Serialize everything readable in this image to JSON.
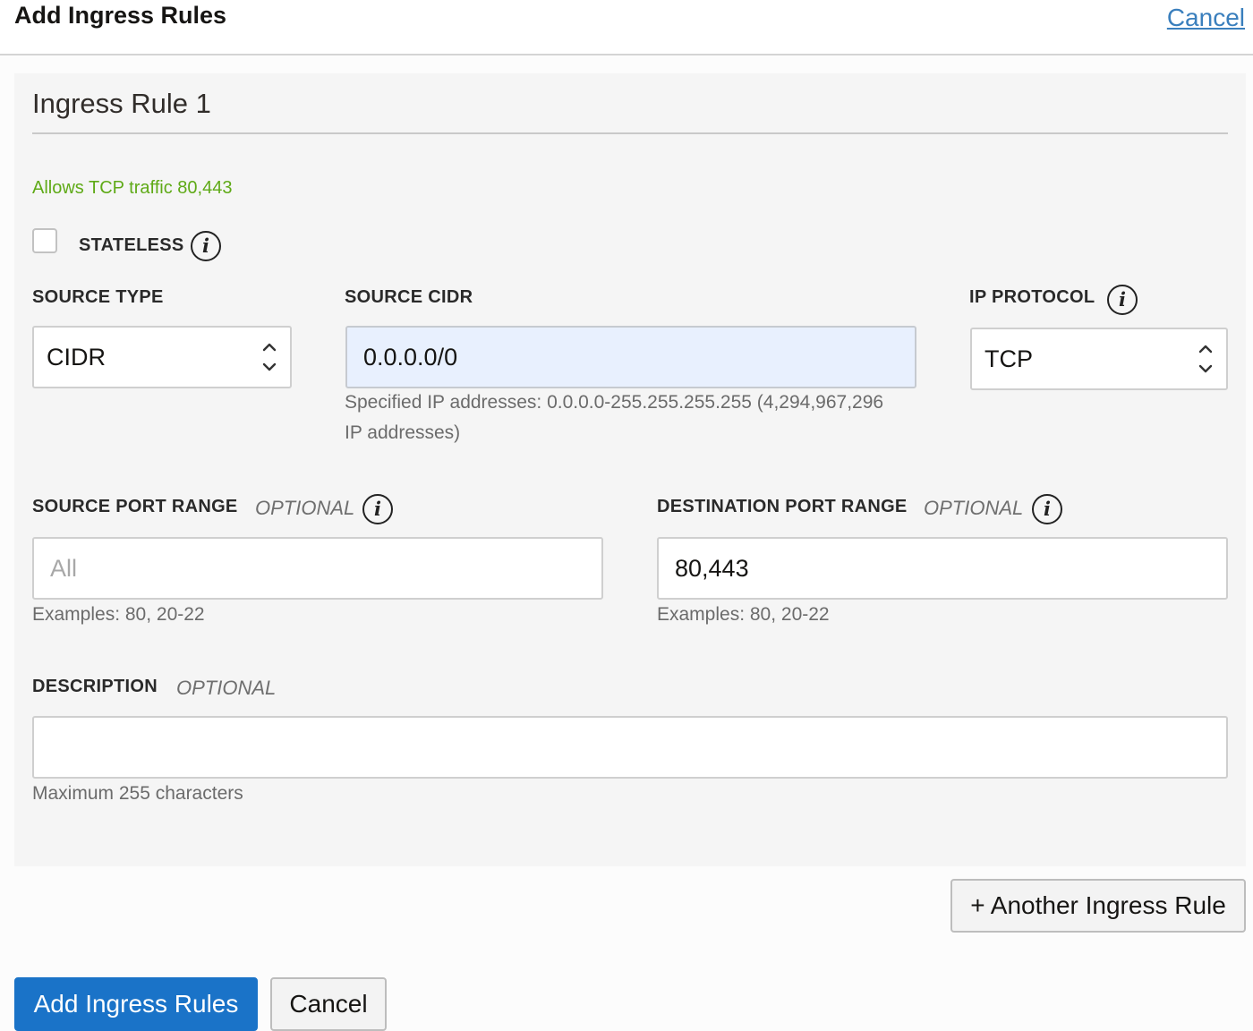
{
  "header": {
    "title": "Add Ingress Rules",
    "cancel_link": "Cancel"
  },
  "rule": {
    "title": "Ingress Rule 1",
    "summary": "Allows TCP traffic 80,443",
    "stateless": {
      "label": "STATELESS",
      "checked": false,
      "info_icon": "info-icon"
    },
    "source_type": {
      "label": "SOURCE TYPE",
      "value": "CIDR"
    },
    "source_cidr": {
      "label": "SOURCE CIDR",
      "value": "0.0.0.0/0",
      "hint_line1": "Specified IP addresses: 0.0.0.0-255.255.255.255 (4,294,967,296",
      "hint_line2": "IP addresses)"
    },
    "ip_protocol": {
      "label": "IP PROTOCOL",
      "value": "TCP",
      "info_icon": "info-icon"
    },
    "source_port_range": {
      "label": "SOURCE PORT RANGE",
      "optional": "OPTIONAL",
      "value": "",
      "placeholder": "All",
      "hint": "Examples: 80, 20-22"
    },
    "destination_port_range": {
      "label": "DESTINATION PORT RANGE",
      "optional": "OPTIONAL",
      "value": "80,443",
      "hint": "Examples: 80, 20-22"
    },
    "description": {
      "label": "DESCRIPTION",
      "optional": "OPTIONAL",
      "value": "",
      "hint": "Maximum 255 characters"
    }
  },
  "actions": {
    "another_rule": "+ Another Ingress Rule",
    "submit": "Add Ingress Rules",
    "cancel": "Cancel"
  },
  "colors": {
    "primary": "#1a73c8",
    "link": "#3a7fbd",
    "summary_green": "#5faa17",
    "autofill_bg": "#e8f0fe"
  }
}
